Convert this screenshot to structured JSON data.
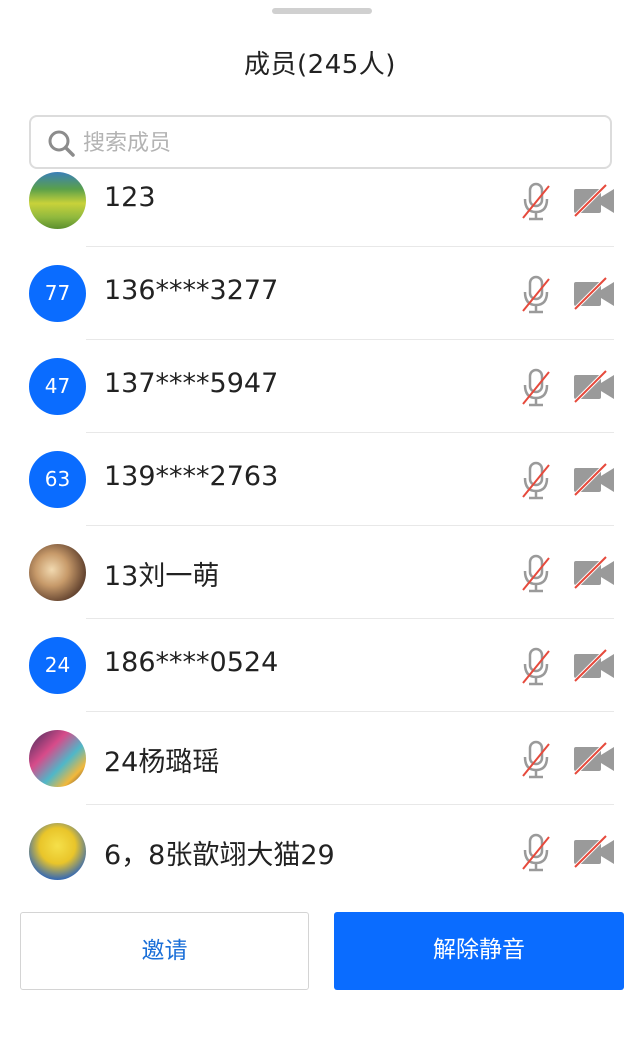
{
  "header": {
    "title": "成员(245人)"
  },
  "search": {
    "placeholder": "搜索成员",
    "value": ""
  },
  "members": [
    {
      "name": "123",
      "avatar_type": "image",
      "avatar_desc": "landscape-photo"
    },
    {
      "name": "136****3277",
      "avatar_type": "number",
      "avatar_text": "77"
    },
    {
      "name": "137****5947",
      "avatar_type": "number",
      "avatar_text": "47"
    },
    {
      "name": "139****2763",
      "avatar_type": "number",
      "avatar_text": "63"
    },
    {
      "name": "13刘一萌",
      "avatar_type": "image",
      "avatar_desc": "room-photo"
    },
    {
      "name": "186****0524",
      "avatar_type": "number",
      "avatar_text": "24"
    },
    {
      "name": "24杨璐瑶",
      "avatar_type": "image",
      "avatar_desc": "colorful-photo"
    },
    {
      "name": "6，8张歆翊大猫29",
      "avatar_type": "image",
      "avatar_desc": "minion-photo"
    }
  ],
  "icons": {
    "search": "search-icon",
    "mic": "mic-muted-icon",
    "camera": "camera-off-icon"
  },
  "footer": {
    "invite_label": "邀请",
    "unmute_label": "解除静音"
  },
  "colors": {
    "accent": "#0a6cff",
    "avatar_bg": "#0a6cff",
    "muted_slash": "#e64a3c",
    "icon_gray": "#9a9a9a"
  }
}
